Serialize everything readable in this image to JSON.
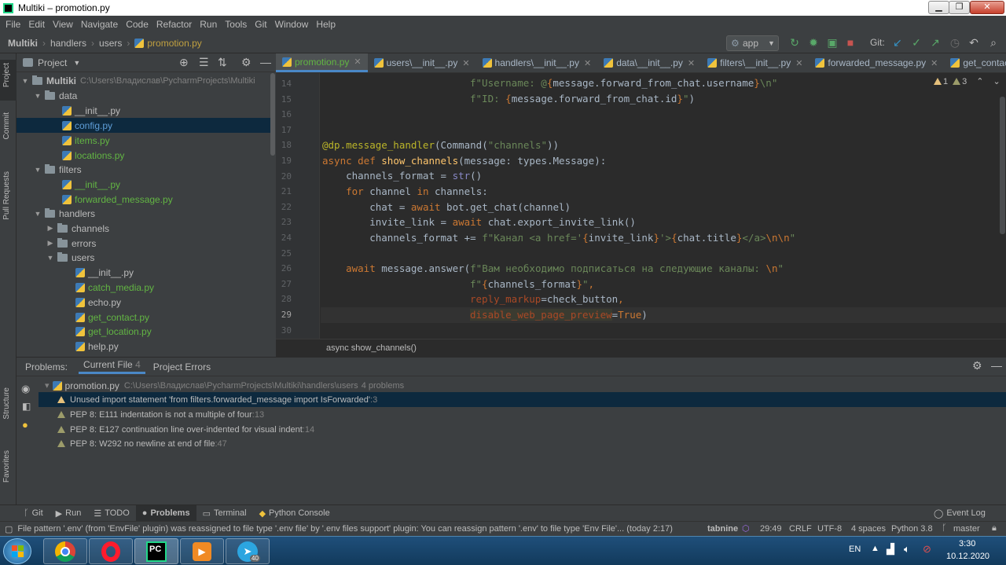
{
  "window": {
    "title": "Multiki – promotion.py",
    "minimize": "▁",
    "maximize": "❐",
    "close": "✕"
  },
  "menu": [
    "File",
    "Edit",
    "View",
    "Navigate",
    "Code",
    "Refactor",
    "Run",
    "Tools",
    "Git",
    "Window",
    "Help"
  ],
  "breadcrumbs": [
    "Multiki",
    "handlers",
    "users",
    "promotion.py"
  ],
  "toolbar": {
    "run_config": "app",
    "git_label": "Git:"
  },
  "left_strip": [
    "Project",
    "Commit",
    "Pull Requests"
  ],
  "left_strip_bottom": [
    "Structure",
    "Favorites"
  ],
  "project": {
    "title": "Project",
    "root_name": "Multiki",
    "root_path": "C:\\Users\\Владислав\\PycharmProjects\\Multiki",
    "items": [
      {
        "label": "data"
      },
      {
        "label": "__init__.py"
      },
      {
        "label": "config.py"
      },
      {
        "label": "items.py"
      },
      {
        "label": "locations.py"
      },
      {
        "label": "filters"
      },
      {
        "label": "__init__.py"
      },
      {
        "label": "forwarded_message.py"
      },
      {
        "label": "handlers"
      },
      {
        "label": "channels"
      },
      {
        "label": "errors"
      },
      {
        "label": "users"
      },
      {
        "label": "__init__.py"
      },
      {
        "label": "catch_media.py"
      },
      {
        "label": "echo.py"
      },
      {
        "label": "get_contact.py"
      },
      {
        "label": "get_location.py"
      },
      {
        "label": "help.py"
      }
    ]
  },
  "tabs": [
    "promotion.py",
    "users\\__init__.py",
    "handlers\\__init__.py",
    "data\\__init__.py",
    "filters\\__init__.py",
    "forwarded_message.py",
    "get_contact.py"
  ],
  "editor": {
    "line_numbers": [
      "14",
      "15",
      "16",
      "17",
      "18",
      "19",
      "20",
      "21",
      "22",
      "23",
      "24",
      "25",
      "26",
      "27",
      "28",
      "29",
      "30"
    ],
    "inspections": {
      "warnings": "1",
      "weak_warnings": "3"
    },
    "breadcrumb": "async show_channels()"
  },
  "problems": {
    "tabs": [
      "Problems:",
      "Current File",
      "Project Errors"
    ],
    "current_count": "4",
    "file": "promotion.py",
    "file_path": "C:\\Users\\Владислав\\PycharmProjects\\Multiki\\handlers\\users",
    "file_count": "4 problems",
    "items": [
      {
        "text": "Unused import statement 'from filters.forwarded_message import IsForwarded'",
        "line": ":3"
      },
      {
        "text": "PEP 8: E111 indentation is not a multiple of four",
        "line": ":13"
      },
      {
        "text": "PEP 8: E127 continuation line over-indented for visual indent",
        "line": ":14"
      },
      {
        "text": "PEP 8: W292 no newline at end of file",
        "line": ":47"
      }
    ]
  },
  "bottom_tools": [
    "Git",
    "Run",
    "TODO",
    "Problems",
    "Terminal",
    "Python Console"
  ],
  "event_log": "Event Log",
  "status": {
    "message": "File pattern '.env' (from 'EnvFile' plugin) was reassigned to file type '.env file' by '.env files support' plugin: You can reassign pattern '.env' to file type 'Env File'... (today 2:17)",
    "tabnine": "tabnine",
    "position": "29:49",
    "line_sep": "CRLF",
    "encoding": "UTF-8",
    "indent": "4 spaces",
    "interpreter": "Python 3.8",
    "branch": "master"
  },
  "taskbar": {
    "lang": "EN",
    "time": "3:30",
    "date": "10.12.2020",
    "telegram_badge": "40",
    "pycharm_label": "PC"
  },
  "colors": {
    "accent": "#4a88c7",
    "selection": "#0d293e",
    "green_file": "#62b543",
    "warning": "#e5c07b"
  }
}
